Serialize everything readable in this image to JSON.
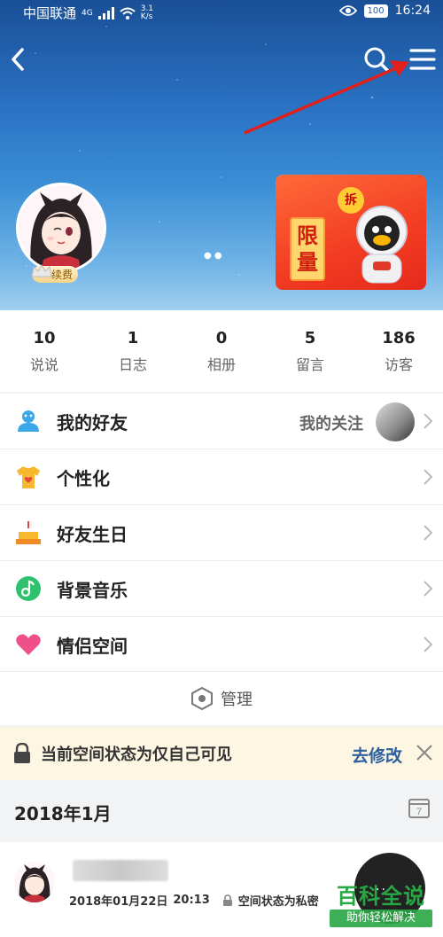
{
  "status_bar": {
    "carrier": "中国联通",
    "network": "4G",
    "speed_value": "3.1",
    "speed_unit": "K/s",
    "battery": "100",
    "time": "16:24"
  },
  "header": {
    "renew_label": "续费"
  },
  "banner": {
    "badge": "拆",
    "text": "限量"
  },
  "stats": [
    {
      "count": "10",
      "label": "说说"
    },
    {
      "count": "1",
      "label": "日志"
    },
    {
      "count": "0",
      "label": "相册"
    },
    {
      "count": "5",
      "label": "留言"
    },
    {
      "count": "186",
      "label": "访客"
    }
  ],
  "menu": {
    "friends": "我的好友",
    "follow": "我的关注",
    "personalize": "个性化",
    "birthday": "好友生日",
    "music": "背景音乐",
    "couple": "情侣空间"
  },
  "manage_label": "管理",
  "notice": {
    "text": "当前空间状态为仅自己可见",
    "action": "去修改"
  },
  "month": {
    "label": "2018年1月",
    "calendar_day": "7"
  },
  "post": {
    "date": "2018年01月22日",
    "time": "20:13",
    "privacy": "空间状态为私密"
  },
  "fab": {
    "more": "···"
  },
  "watermark": {
    "main": "百科全说",
    "sub": "助你轻松解决"
  },
  "colors": {
    "accent_blue": "#2b5f9e",
    "notice_bg": "#fdf6e3",
    "banner_red": "#f23c22",
    "watermark_green": "#28a745"
  }
}
